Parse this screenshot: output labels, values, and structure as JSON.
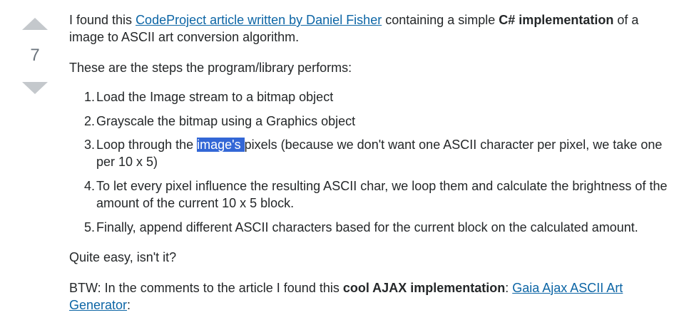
{
  "vote": {
    "count": "7",
    "upvote_icon": "triangle-up",
    "downvote_icon": "triangle-down"
  },
  "colors": {
    "link": "#0c65a5",
    "text": "#242729",
    "vote_arrow": "#c4c8cc",
    "vote_count": "#6a737c",
    "selection_bg": "#3367d6"
  },
  "intro": {
    "t1": "I found this ",
    "link1": "CodeProject article written by Daniel Fisher",
    "t2": " containing a simple ",
    "bold1": "C# implementation",
    "t3": " of a image to ASCII art conversion algorithm."
  },
  "steps_intro": "These are the steps the program/library performs:",
  "steps": [
    {
      "num": "1.",
      "text": "Load the Image stream to a bitmap object"
    },
    {
      "num": "2.",
      "text": "Grayscale the bitmap using a Graphics object"
    },
    {
      "num": "3.",
      "before": "Loop through the ",
      "selected": "image's ",
      "after": "pixels (because we don't want one ASCII character per pixel, we take one per 10 x 5)"
    },
    {
      "num": "4.",
      "text": "To let every pixel influence the resulting ASCII char, we loop them and calculate the brightness of the amount of the current 10 x 5 block."
    },
    {
      "num": "5.",
      "text": "Finally, append different ASCII characters based for the current block on the calculated amount."
    }
  ],
  "easy": "Quite easy, isn't it?",
  "btw": {
    "t1": "BTW: In the comments to the article I found this ",
    "bold1": "cool AJAX implementation",
    "t2": ": ",
    "link1": "Gaia Ajax ASCII Art Generator",
    "t3": ":"
  }
}
